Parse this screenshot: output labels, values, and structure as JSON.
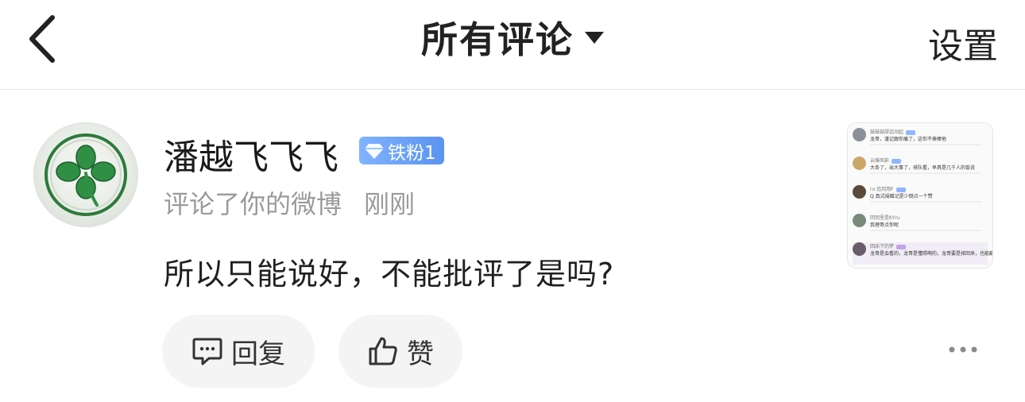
{
  "header": {
    "title": "所有评论",
    "settings_label": "设置"
  },
  "comment": {
    "username": "潘越飞飞飞",
    "badge": "铁粉1",
    "action": "评论了你的微博",
    "time": "刚刚",
    "text": "所以只能说好，不能批评了是吗?",
    "reply_label": "回复",
    "like_label": "赞"
  },
  "thumbnail": {
    "comments": [
      {
        "name": "鼓鼓鼓甜话动起",
        "text": "龙哥，谨记跟你痛了，这你不捧棒他"
      },
      {
        "name": "云爆风影",
        "text": "大条了，出大事了，排队看，早具是几千人的饭说"
      },
      {
        "name": "ru·追到用F",
        "text": "Q 真试捐赠记是少倒点一个赞"
      },
      {
        "name": "回到里是KYru",
        "text": "我理哥点你呢"
      },
      {
        "name": "回床下的梦",
        "text": "龙哥是会看的，龙哥是懂照啊的，龙哥要是择回来，也能翻的戏弄权惊"
      }
    ]
  },
  "colors": {
    "badge": "#5b93f0",
    "muted": "#9a9a9a",
    "pill_bg": "#f4f4f4"
  }
}
